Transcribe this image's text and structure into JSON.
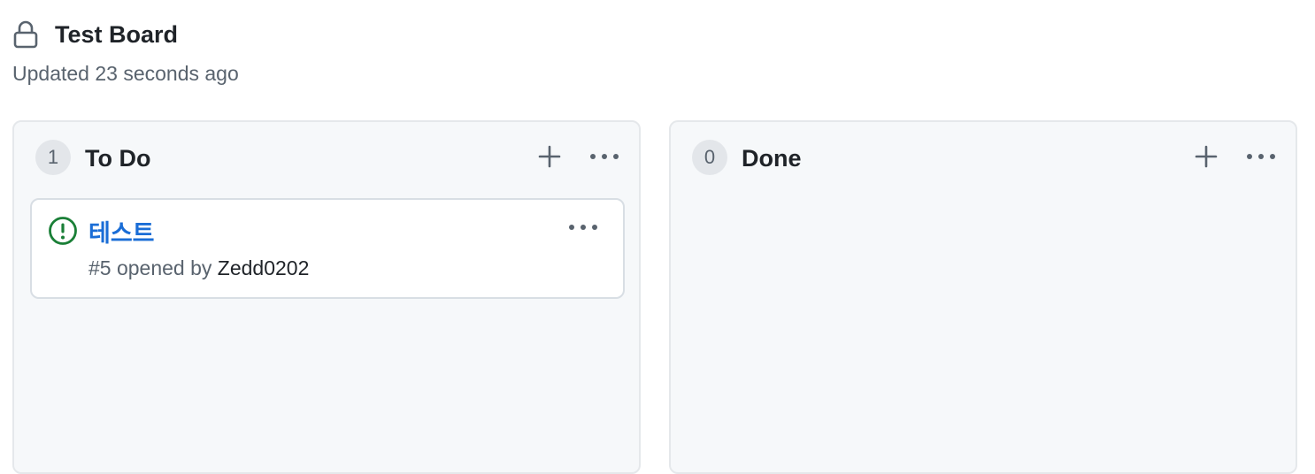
{
  "board": {
    "title": "Test Board",
    "updated": "Updated 23 seconds ago"
  },
  "columns": [
    {
      "count": "1",
      "title": "To Do",
      "cards": [
        {
          "title": "테스트",
          "meta_prefix": "#5 opened by ",
          "author": "Zedd0202",
          "status_icon": "issue-opened-icon",
          "status_color": "#1a7f37"
        }
      ]
    },
    {
      "count": "0",
      "title": "Done",
      "cards": []
    }
  ],
  "icons": {
    "lock": "lock-icon",
    "add": "plus-icon",
    "menu": "kebab-horizontal-icon"
  }
}
